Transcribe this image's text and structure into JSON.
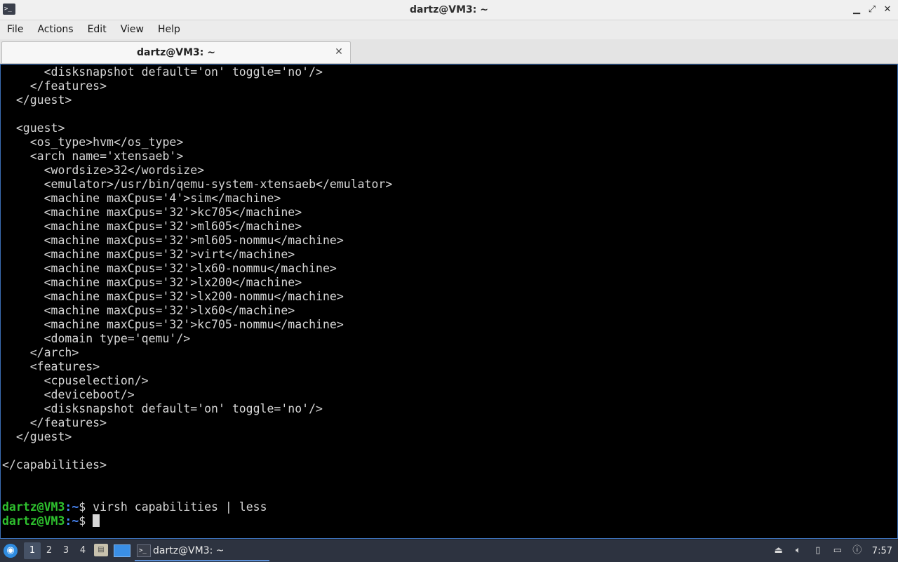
{
  "window": {
    "title": "dartz@VM3: ~",
    "app_icon_glyph": ">_",
    "controls": {
      "minimize": "▁",
      "maximize": "⤢",
      "close": "✕"
    }
  },
  "menu": {
    "items": [
      "File",
      "Actions",
      "Edit",
      "View",
      "Help"
    ]
  },
  "tabs": [
    {
      "label": "dartz@VM3: ~",
      "close_glyph": "✕"
    }
  ],
  "terminal": {
    "colors": {
      "background": "#000000",
      "foreground": "#d6d6d6",
      "prompt_user": "#2ec12e",
      "prompt_path": "#4b8bff"
    },
    "output_lines": [
      "      <disksnapshot default='on' toggle='no'/>",
      "    </features>",
      "  </guest>",
      "",
      "  <guest>",
      "    <os_type>hvm</os_type>",
      "    <arch name='xtensaeb'>",
      "      <wordsize>32</wordsize>",
      "      <emulator>/usr/bin/qemu-system-xtensaeb</emulator>",
      "      <machine maxCpus='4'>sim</machine>",
      "      <machine maxCpus='32'>kc705</machine>",
      "      <machine maxCpus='32'>ml605</machine>",
      "      <machine maxCpus='32'>ml605-nommu</machine>",
      "      <machine maxCpus='32'>virt</machine>",
      "      <machine maxCpus='32'>lx60-nommu</machine>",
      "      <machine maxCpus='32'>lx200</machine>",
      "      <machine maxCpus='32'>lx200-nommu</machine>",
      "      <machine maxCpus='32'>lx60</machine>",
      "      <machine maxCpus='32'>kc705-nommu</machine>",
      "      <domain type='qemu'/>",
      "    </arch>",
      "    <features>",
      "      <cpuselection/>",
      "      <deviceboot/>",
      "      <disksnapshot default='on' toggle='no'/>",
      "    </features>",
      "  </guest>",
      "",
      "</capabilities>",
      "",
      ""
    ],
    "prompt_lines": [
      {
        "user": "dartz@VM3",
        "path": ":~",
        "symbol": "$",
        "command": " virsh capabilities | less"
      },
      {
        "user": "dartz@VM3",
        "path": ":~",
        "symbol": "$",
        "command": " "
      }
    ]
  },
  "taskbar": {
    "start_icon": "start-menu-icon",
    "workspaces": [
      "1",
      "2",
      "3",
      "4"
    ],
    "active_workspace": "1",
    "task_label": "dartz@VM3: ~",
    "tray_icons": [
      "eject-icon",
      "volume-icon",
      "clipboard-icon",
      "network-icon",
      "notification-icon"
    ],
    "clock": "7:57"
  }
}
